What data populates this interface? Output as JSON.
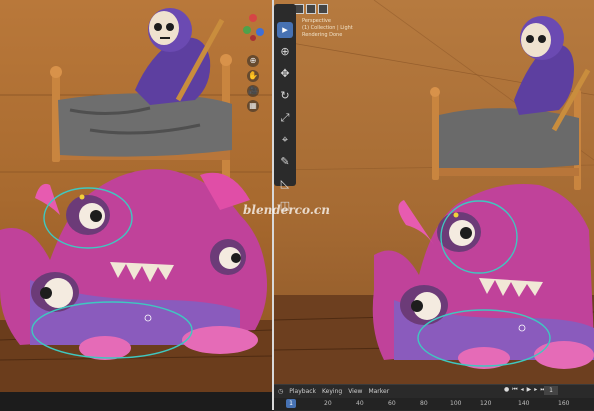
{
  "overlay": {
    "line1": "Perspective",
    "line2": "(1) Collection | Light",
    "line3": "Rendering Done"
  },
  "watermark": "blenderco.cn",
  "toolbar": {
    "tools": [
      {
        "icon": "cursor-select-icon",
        "glyph": "▸",
        "active": true
      },
      {
        "icon": "cursor-3d-icon",
        "glyph": "⊕",
        "active": false
      },
      {
        "icon": "move-icon",
        "glyph": "✥",
        "active": false
      },
      {
        "icon": "rotate-icon",
        "glyph": "↻",
        "active": false
      },
      {
        "icon": "scale-icon",
        "glyph": "⤢",
        "active": false
      },
      {
        "icon": "transform-icon",
        "glyph": "⌖",
        "active": false
      },
      {
        "icon": "annotate-icon",
        "glyph": "✎",
        "active": false
      },
      {
        "icon": "measure-icon",
        "glyph": "◺",
        "active": false
      },
      {
        "icon": "add-cube-icon",
        "glyph": "◫",
        "active": false
      }
    ]
  },
  "gizmo": {
    "buttons": [
      "⊕",
      "✋",
      "🎥",
      "▦"
    ]
  },
  "timeline": {
    "playback_label": "Playback",
    "keying_label": "Keying",
    "view_label": "View",
    "marker_label": "Marker",
    "current_frame": "1",
    "frames": [
      "20",
      "40",
      "60",
      "80",
      "100",
      "120",
      "140",
      "160"
    ],
    "frame_box": "1"
  },
  "colors": {
    "accent": "#4772b3",
    "selection_ring": "#3fc8c0",
    "light_dot": "#f2d23a"
  }
}
